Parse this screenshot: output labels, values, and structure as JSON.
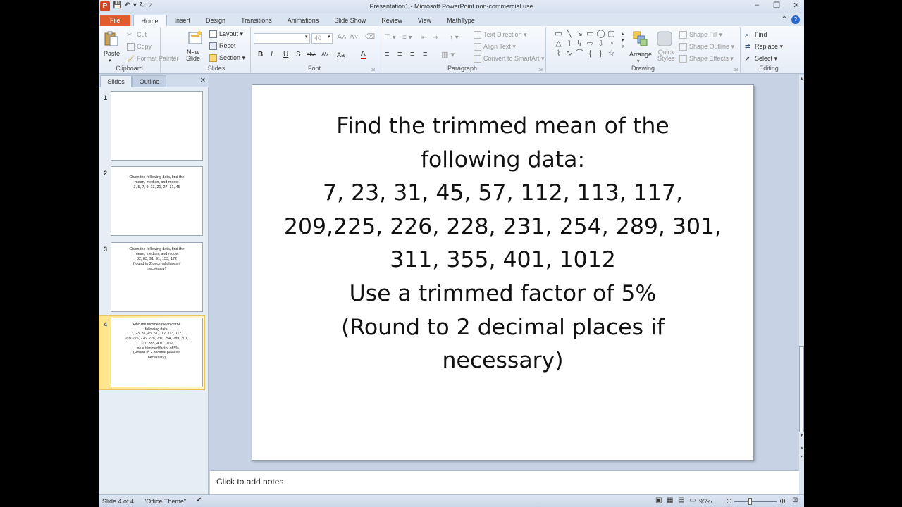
{
  "window": {
    "title": "Presentation1  -  Microsoft PowerPoint non-commercial use",
    "app_icon_letter": "P"
  },
  "ribbon_tabs": [
    "File",
    "Home",
    "Insert",
    "Design",
    "Transitions",
    "Animations",
    "Slide Show",
    "Review",
    "View",
    "MathType"
  ],
  "active_tab": "Home",
  "ribbon": {
    "clipboard": {
      "paste": "Paste",
      "cut": "Cut",
      "copy": "Copy",
      "format_painter": "Format Painter",
      "label": "Clipboard"
    },
    "slides": {
      "new_slide": "New\nSlide",
      "layout": "Layout",
      "reset": "Reset",
      "section": "Section",
      "label": "Slides"
    },
    "font": {
      "font_size": "40",
      "label": "Font",
      "bold": "B",
      "italic": "I",
      "underline": "U",
      "strike": "S",
      "shadow": "abc",
      "spacing": "AV",
      "case": "Aa",
      "color": "A"
    },
    "paragraph": {
      "text_direction": "Text Direction",
      "align_text": "Align Text",
      "convert_smartart": "Convert to SmartArt",
      "label": "Paragraph"
    },
    "drawing": {
      "arrange": "Arrange",
      "quick_styles": "Quick\nStyles",
      "shape_fill": "Shape Fill",
      "shape_outline": "Shape Outline",
      "shape_effects": "Shape Effects",
      "label": "Drawing"
    },
    "editing": {
      "find": "Find",
      "replace": "Replace",
      "select": "Select",
      "label": "Editing"
    }
  },
  "pane": {
    "tab_slides": "Slides",
    "tab_outline": "Outline"
  },
  "thumbnails": [
    {
      "num": "1",
      "text": ""
    },
    {
      "num": "2",
      "text": "Given the following data, find the\nmean, median, and mode:\n3, 5, 7, 9, 13, 21, 27, 31, 45"
    },
    {
      "num": "3",
      "text": "Given the following data, find the\nmean, median, and mode:\n82, 83, 91, 91, 153, 172\n(round to 2 decimal places if\nnecessary)"
    },
    {
      "num": "4",
      "text": "Find the trimmed mean of the\nfollowing data:\n7, 23, 31, 45, 57, 112, 113, 117,\n209,225, 226, 228, 231, 254, 289, 301,\n311, 355, 401, 1012\nUse a trimmed factor of 5%\n(Round to 2 decimal places if\nnecessary)"
    }
  ],
  "selected_slide": 4,
  "slide": {
    "text": "Find the trimmed mean of the\nfollowing data:\n7, 23, 31, 45, 57, 112, 113, 117,\n209,225, 226, 228, 231, 254, 289, 301,\n311, 355, 401, 1012\nUse a trimmed factor of 5%\n(Round to 2 decimal places if\nnecessary)"
  },
  "notes_placeholder": "Click to add notes",
  "status": {
    "slide_info": "Slide 4 of 4",
    "theme": "\"Office Theme\"",
    "zoom": "95%"
  }
}
